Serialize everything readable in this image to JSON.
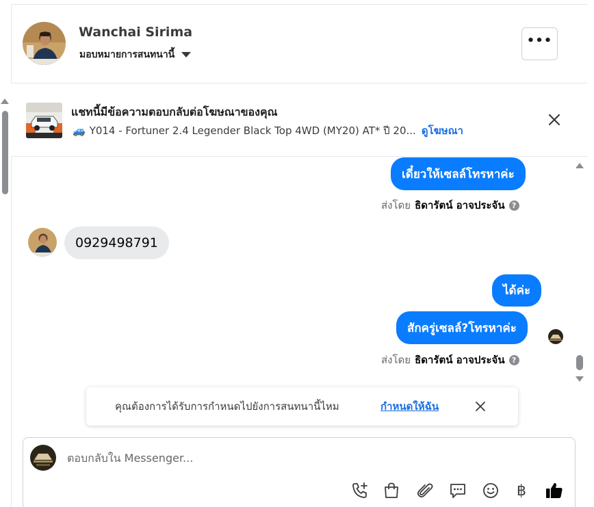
{
  "header": {
    "contact_name": "Wanchai Sirima",
    "assign_label": "มอบหมายการสนทนานี้",
    "more_label": "•••"
  },
  "ad_banner": {
    "title": "แชทนี้มีข้อความตอบกลับต่อโฆษณาของคุณ",
    "car_emoji": "🚙",
    "subtitle": "Y014 - Fortuner 2.4 Legender Black Top 4WD (MY20) AT* ปี 20...",
    "link": "ดูโฆษณา"
  },
  "messages": {
    "out_1": "เดี๋ยวให้เซลล์โทรหาค่ะ",
    "sent_by_1_prefix": "ส่งโดย",
    "sent_by_1_name": "ธิดารัตน์ อาจประจัน",
    "in_1": "0929498791",
    "out_2": "ได้ค่ะ",
    "out_3": "สักครู่เซลล์?โทรหาค่ะ",
    "sent_by_2_prefix": "ส่งโดย",
    "sent_by_2_name": "ธิดารัตน์ อาจประจัน",
    "help_glyph": "?"
  },
  "assign_prompt": {
    "text": "คุณต้องการได้รับการกำหนดไปยังการสนทนานี้ไหม",
    "link": "กำหนดให้ฉัน"
  },
  "composer": {
    "placeholder": "ตอบกลับใน Messenger...",
    "value": "",
    "baht_glyph": "฿"
  },
  "colors": {
    "accent": "#0a7cff",
    "link": "#1a6fe0",
    "incoming_bubble": "#e9eaec",
    "like": "#050505"
  }
}
